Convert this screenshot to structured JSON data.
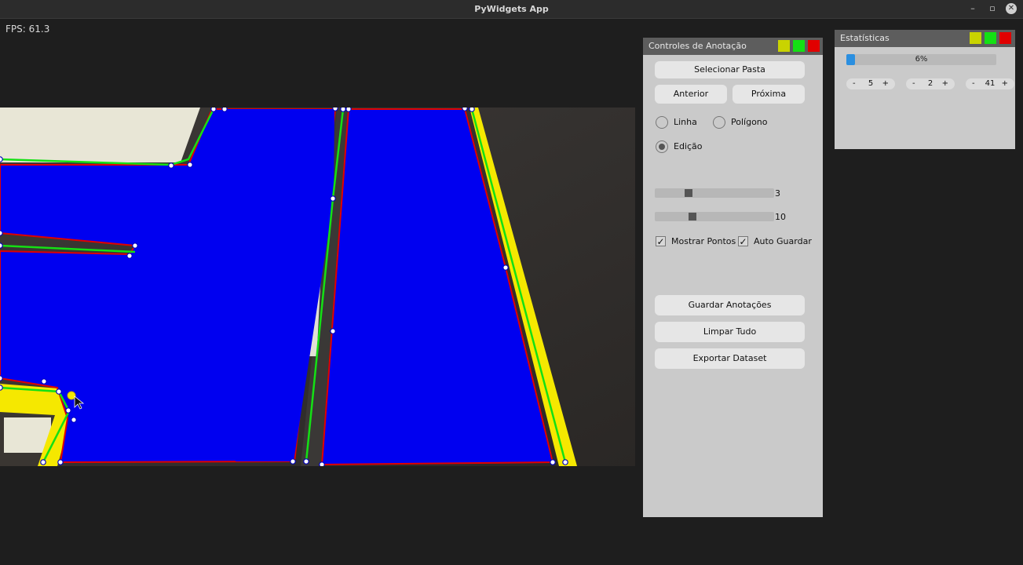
{
  "window": {
    "title": "PyWidgets App",
    "minimize": "–",
    "maximize": "▫",
    "close": "✕"
  },
  "fps": "FPS: 61.3",
  "colors": {
    "polygon_fill": "#0000f0",
    "polygon_edge": "#e00000",
    "line": "#14e014",
    "vertex": "#ffffff",
    "accent_yellow": "#f5e800",
    "progress": "#2b8fe0"
  },
  "controls": {
    "title": "Controles de Anotação",
    "select_folder": "Selecionar Pasta",
    "previous": "Anterior",
    "next": "Próxima",
    "modes": [
      {
        "label": "Linha",
        "selected": false
      },
      {
        "label": "Polígono",
        "selected": false
      },
      {
        "label": "Edição",
        "selected": true
      }
    ],
    "sliders": [
      {
        "value": "3",
        "fraction": 0.27
      },
      {
        "value": "10",
        "fraction": 0.3
      }
    ],
    "checkboxes": [
      {
        "label": "Mostrar Pontos",
        "checked": true,
        "mark": "✓"
      },
      {
        "label": "Auto Guardar",
        "checked": true,
        "mark": "✓"
      }
    ],
    "save": "Guardar Anotações",
    "clear": "Limpar Tudo",
    "export": "Exportar Dataset"
  },
  "stats": {
    "title": "Estatísticas",
    "progress_text": "6%",
    "progress_fraction": 0.06,
    "steppers": [
      {
        "minus": "-",
        "value": "5",
        "plus": "+"
      },
      {
        "minus": "-",
        "value": "2",
        "plus": "+"
      },
      {
        "minus": "-",
        "value": "41",
        "plus": "+"
      }
    ]
  }
}
